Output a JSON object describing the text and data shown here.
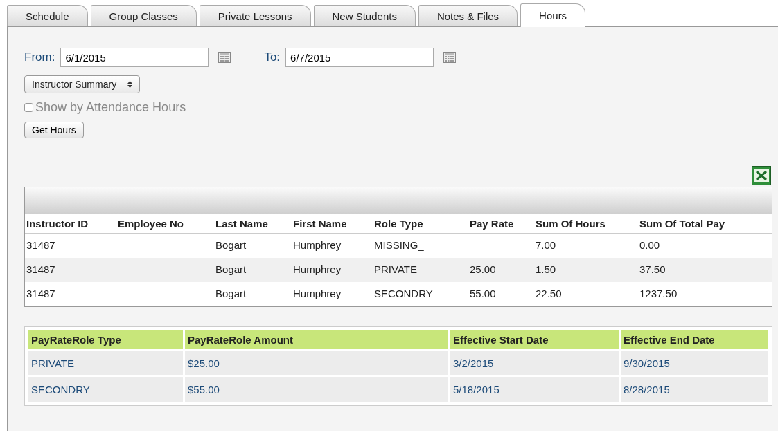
{
  "tabs": [
    {
      "label": "Schedule",
      "selected": false
    },
    {
      "label": "Group Classes",
      "selected": false
    },
    {
      "label": "Private Lessons",
      "selected": false
    },
    {
      "label": "New Students",
      "selected": false
    },
    {
      "label": "Notes & Files",
      "selected": false
    },
    {
      "label": "Hours",
      "selected": true
    }
  ],
  "filters": {
    "from_label": "From:",
    "from_value": "6/1/2015",
    "to_label": "To:",
    "to_value": "6/7/2015",
    "report_select": "Instructor Summary",
    "attendance_checkbox": {
      "label": "Show by Attendance Hours",
      "checked": false
    },
    "get_button": "Get Hours"
  },
  "hours_table": {
    "columns": [
      "Instructor ID",
      "Employee No",
      "Last Name",
      "First Name",
      "Role Type",
      "Pay Rate",
      "Sum Of Hours",
      "Sum Of Total Pay"
    ],
    "rows": [
      [
        "31487",
        "",
        "Bogart",
        "Humphrey",
        "MISSING_",
        "",
        "7.00",
        "0.00"
      ],
      [
        "31487",
        "",
        "Bogart",
        "Humphrey",
        "PRIVATE",
        "25.00",
        "1.50",
        "37.50"
      ],
      [
        "31487",
        "",
        "Bogart",
        "Humphrey",
        "SECONDRY",
        "55.00",
        "22.50",
        "1237.50"
      ]
    ]
  },
  "pay_rate_table": {
    "columns": [
      "PayRateRole Type",
      "PayRateRole Amount",
      "Effective Start Date",
      "Effective End Date"
    ],
    "rows": [
      [
        "PRIVATE",
        "$25.00",
        "3/2/2015",
        "9/30/2015"
      ],
      [
        "SECONDRY",
        "$55.00",
        "5/18/2015",
        "8/28/2015"
      ]
    ]
  }
}
